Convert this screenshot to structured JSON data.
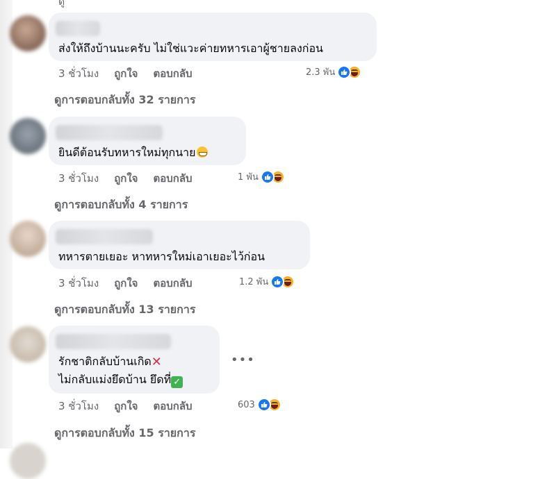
{
  "top_remnant": "ดู",
  "comments": [
    {
      "lines": [
        "ส่งให้ถึงบ้านนะครับ ไม่ใช่แวะค่ายทหารเอาผู้ชายลงก่อน"
      ],
      "time": "3 ชั่วโมง",
      "like_label": "ถูกใจ",
      "reply_label": "ตอบกลับ",
      "reaction_count": "2.3 พัน",
      "view_replies": "ดูการตอบกลับทั้ง 32 รายการ"
    },
    {
      "lines": [
        "ยินดีต้อนรับทหารใหม่ทุกนาย"
      ],
      "emoji": "grin-emoji",
      "time": "3 ชั่วโมง",
      "like_label": "ถูกใจ",
      "reply_label": "ตอบกลับ",
      "reaction_count": "1 พัน",
      "view_replies": "ดูการตอบกลับทั้ง 4 รายการ"
    },
    {
      "lines": [
        "ทหารตายเยอะ หาทหารใหม่เอาเยอะไว้ก่อน"
      ],
      "time": "3 ชั่วโมง",
      "like_label": "ถูกใจ",
      "reply_label": "ตอบกลับ",
      "reaction_count": "1.2 พัน",
      "view_replies": "ดูการตอบกลับทั้ง 13 รายการ"
    },
    {
      "lines": [
        "รักชาติกลับบ้านเกิด",
        "ไม่กลับแม่งยึดบ้าน ยึดที่"
      ],
      "emoji_line1": "cross-mark-emoji",
      "emoji_line2": "check-mark-emoji",
      "more_icon": "•••",
      "time": "3 ชั่วโมง",
      "like_label": "ถูกใจ",
      "reply_label": "ตอบกลับ",
      "reaction_count": "603",
      "view_replies": "ดูการตอบกลับทั้ง 15 รายการ"
    }
  ],
  "colors": {
    "bubble": "#f0f2f5",
    "meta_text": "#65676b",
    "like": "#1877f2",
    "haha": "#f7b125"
  }
}
